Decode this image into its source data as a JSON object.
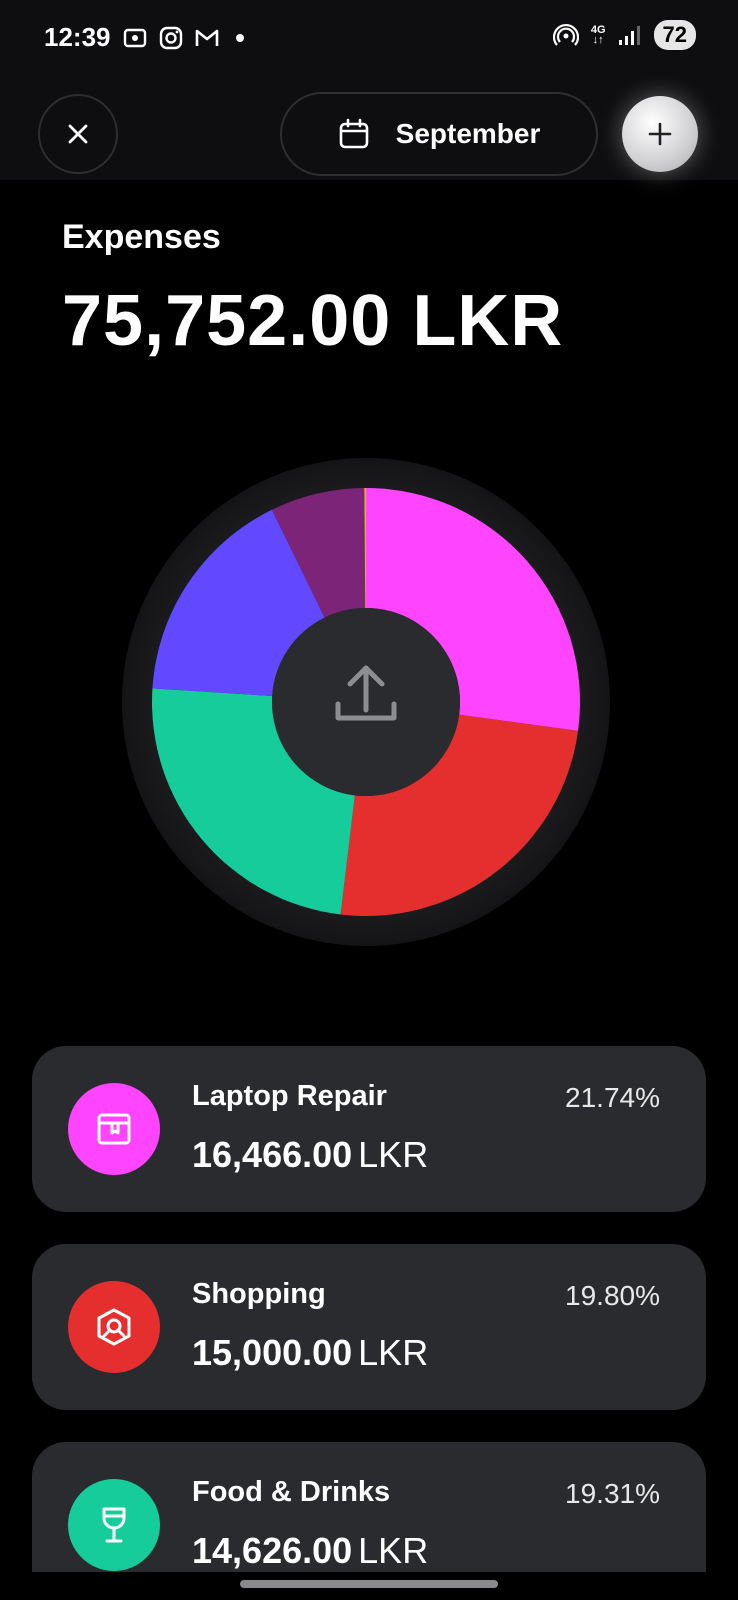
{
  "status_bar": {
    "time": "12:39",
    "network": "4G",
    "battery": "72",
    "icons": [
      "screenshot-icon",
      "instagram-icon",
      "gmail-icon",
      "hotspot-icon",
      "signal-icon"
    ]
  },
  "header": {
    "month": "September"
  },
  "summary": {
    "label": "Expenses",
    "total": "75,752.00 LKR"
  },
  "chart_data": {
    "type": "pie",
    "series": [
      {
        "value": 21.74,
        "color": "#ff44ff"
      },
      {
        "value": 19.8,
        "color": "#e52f2f"
      },
      {
        "value": 19.31,
        "color": "#16cc9b"
      },
      {
        "value": 13.4,
        "color": "#6248ff"
      },
      {
        "value": 5.7,
        "color": "#7c2478"
      },
      {
        "value": 0.1,
        "color": "#e6b02a"
      }
    ],
    "center_icon": "upload-icon"
  },
  "categories": [
    {
      "name": "Laptop Repair",
      "amount": "16,466.00",
      "currency": "LKR",
      "percent": "21.74%",
      "color": "#ff44ff",
      "icon": "box-icon"
    },
    {
      "name": "Shopping",
      "amount": "15,000.00",
      "currency": "LKR",
      "percent": "19.80%",
      "color": "#e52f2f",
      "icon": "shopping-icon"
    },
    {
      "name": "Food & Drinks",
      "amount": "14,626.00",
      "currency": "LKR",
      "percent": "19.31%",
      "color": "#16cc9b",
      "icon": "wine-glass-icon"
    }
  ]
}
